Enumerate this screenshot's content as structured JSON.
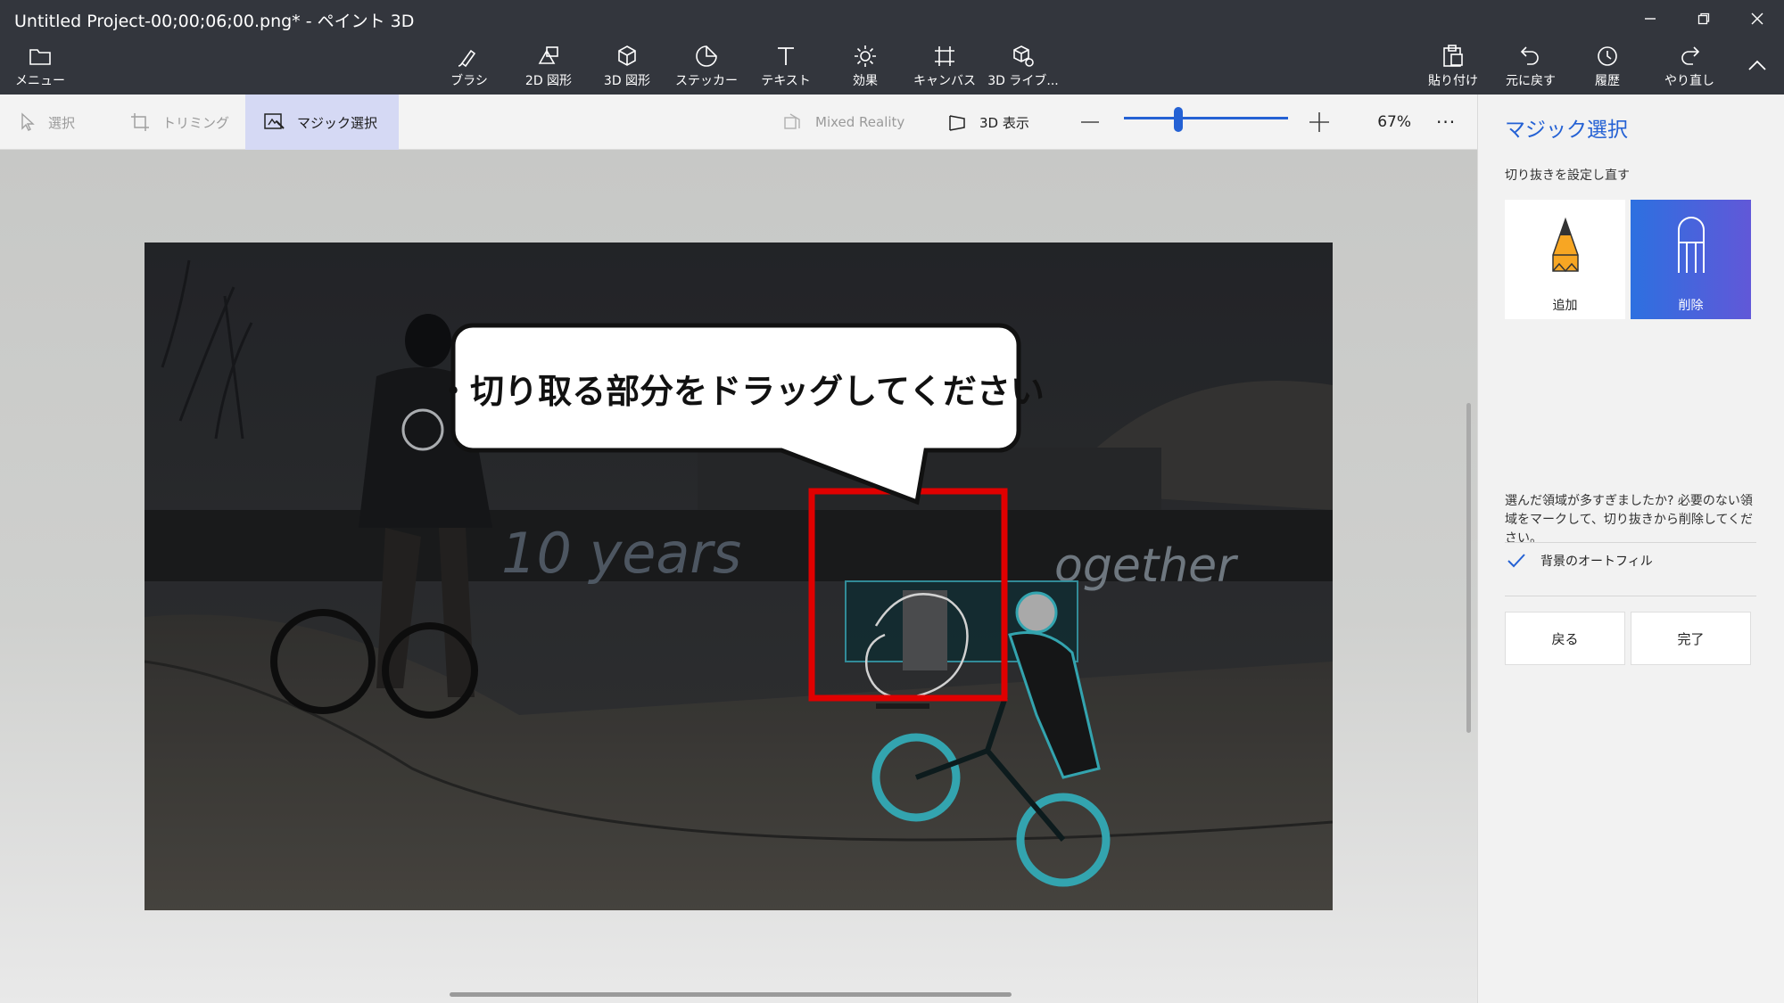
{
  "window": {
    "title": "Untitled Project-00;00;06;00.png* - ペイント 3D"
  },
  "toolbar": {
    "menu_label": "メニュー",
    "tools": [
      {
        "label": "ブラシ",
        "icon": "brush-icon"
      },
      {
        "label": "2D 図形",
        "icon": "2d-shapes-icon"
      },
      {
        "label": "3D 図形",
        "icon": "3d-shapes-icon"
      },
      {
        "label": "ステッカー",
        "icon": "sticker-icon"
      },
      {
        "label": "テキスト",
        "icon": "text-icon"
      },
      {
        "label": "効果",
        "icon": "effects-icon"
      },
      {
        "label": "キャンバス",
        "icon": "canvas-icon"
      },
      {
        "label": "3D ライブ...",
        "icon": "3d-library-icon"
      }
    ],
    "right": [
      {
        "label": "貼り付け",
        "icon": "paste-icon"
      },
      {
        "label": "元に戻す",
        "icon": "undo-icon"
      },
      {
        "label": "履歴",
        "icon": "history-icon"
      },
      {
        "label": "やり直し",
        "icon": "redo-icon"
      }
    ]
  },
  "subbar": {
    "select_label": "選択",
    "trim_label": "トリミング",
    "magic_select_label": "マジック選択",
    "mixed_reality_label": "Mixed Reality",
    "view3d_label": "3D 表示",
    "zoom_percent": "67%",
    "zoom_fraction": 0.33,
    "more_label": "···"
  },
  "canvas": {
    "callout_text": "・切り取る部分をドラッグしてください",
    "highlight_color": "#e00000"
  },
  "panel": {
    "title": "マジック選択",
    "subtitle": "切り抜きを設定し直す",
    "add_label": "追加",
    "remove_label": "削除",
    "help_text": "選んだ領域が多すぎましたか? 必要のない領域をマークして、切り抜きから削除してください。",
    "autofill_label": "背景のオートフィル",
    "autofill_checked": true,
    "back_label": "戻る",
    "done_label": "完了"
  },
  "colors": {
    "accent": "#2461d4",
    "titlebar": "#33363d"
  }
}
